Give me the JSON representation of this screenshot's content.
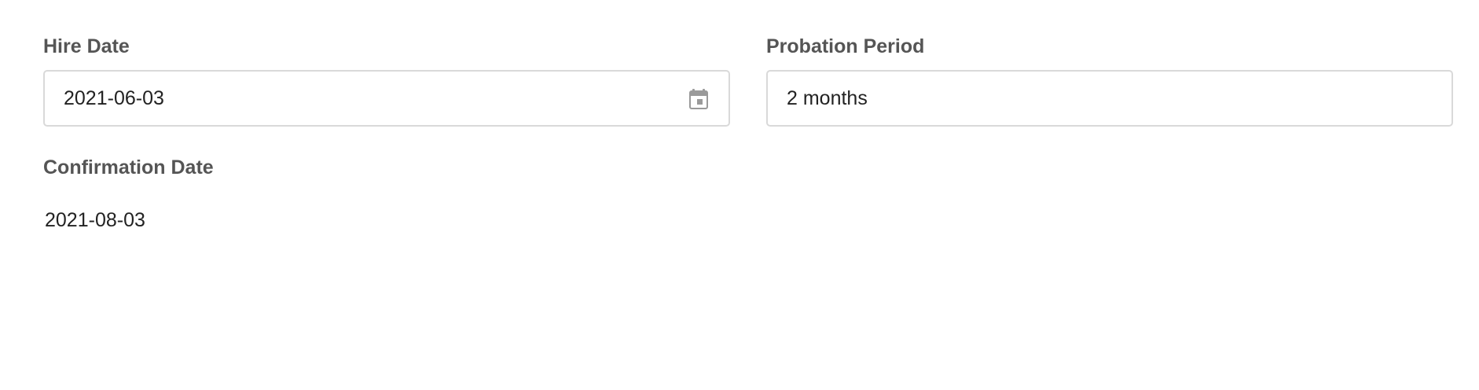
{
  "hire_date": {
    "label": "Hire Date",
    "value": "2021-06-03",
    "icon": "calendar-icon"
  },
  "probation_period": {
    "label": "Probation Period",
    "value": "2 months"
  },
  "confirmation_date": {
    "label": "Confirmation Date",
    "value": "2021-08-03"
  },
  "colors": {
    "label_text": "#555555",
    "value_text": "#222222",
    "input_border": "#d9d9d9",
    "icon": "#9a9a9a"
  }
}
